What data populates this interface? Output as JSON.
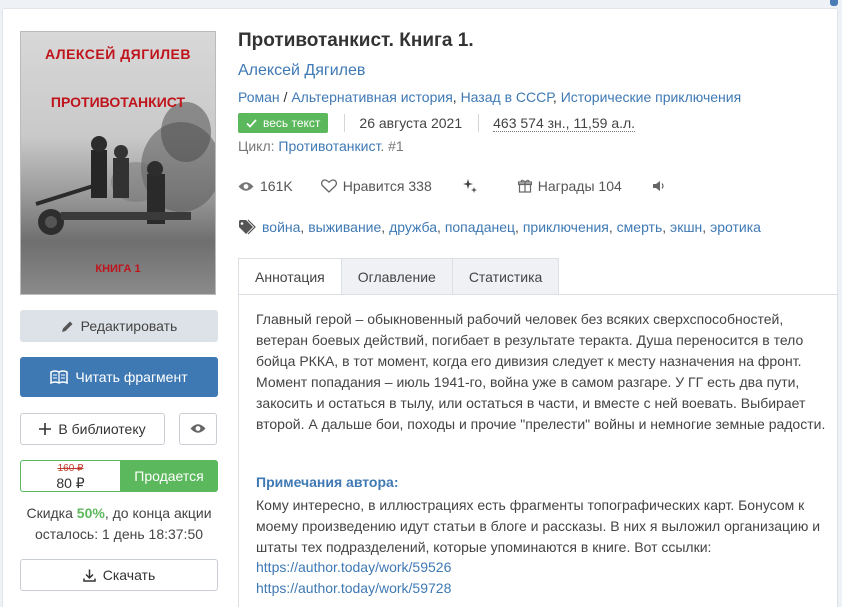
{
  "cover": {
    "author_text": "АЛЕКСЕЙ  ДЯГИЛЕВ",
    "title_text": "ПРОТИВОТАНКИСТ",
    "book_text": "КНИГА 1"
  },
  "actions": {
    "edit": "Редактировать",
    "read": "Читать фрагмент",
    "library": "В библиотеку",
    "price_old": "160 ₽",
    "price_new": "80 ₽",
    "sale": "Продается",
    "discount_prefix": "Скидка ",
    "discount_pct": "50%",
    "discount_suffix": ", до конца акции осталось: 1 день 18:37:50",
    "download": "Скачать"
  },
  "book": {
    "title": "Противотанкист. Книга 1.",
    "author": "Алексей Дягилев",
    "genres": [
      "Роман",
      "Альтернативная история",
      "Назад в СССР",
      "Исторические приключения"
    ],
    "badge": "весь текст",
    "date": "26 августа 2021",
    "size": "463 574 зн., 11,59 а.л.",
    "cycle_label": "Цикл: ",
    "cycle_name": "Противотанкист",
    "cycle_num": ". #1"
  },
  "stats": {
    "views": "161K",
    "likes": "Нравится 338",
    "awards": "Награды 104"
  },
  "tags": [
    "война",
    "выживание",
    "дружба",
    "попаданец",
    "приключения",
    "смерть",
    "экшн",
    "эротика"
  ],
  "tabs": [
    "Аннотация",
    "Оглавление",
    "Статистика"
  ],
  "annotation": "Главный герой – обыкновенный рабочий человек без всяких сверхспособностей, ветеран боевых действий, погибает в результате теракта. Душа переносится в тело бойца РККА, в тот момент, когда его дивизия следует к месту назначения на фронт. Момент попадания – июль 1941-го, война уже в самом разгаре. У ГГ есть два пути, закосить и остаться в тылу, или остаться в части, и вместе с ней воевать. Выбирает второй. А дальше бои, походы и прочие \"прелести\" войны и немногие земные радости.",
  "notes_heading": "Примечания автора:",
  "notes": "Кому интересно, в иллюстрациях есть фрагменты топографических карт. Бонусом к моему произведению идут статьи в блоге и рассказы. В них я выложил организацию и штаты тех подразделений, которые упоминаются в книге. Вот ссылки:",
  "links": [
    "https://author.today/work/59526",
    "https://author.today/work/59728"
  ],
  "colors": {
    "accent": "#3f79b4",
    "green": "#5cb85c",
    "old_price": "#c0392b"
  }
}
